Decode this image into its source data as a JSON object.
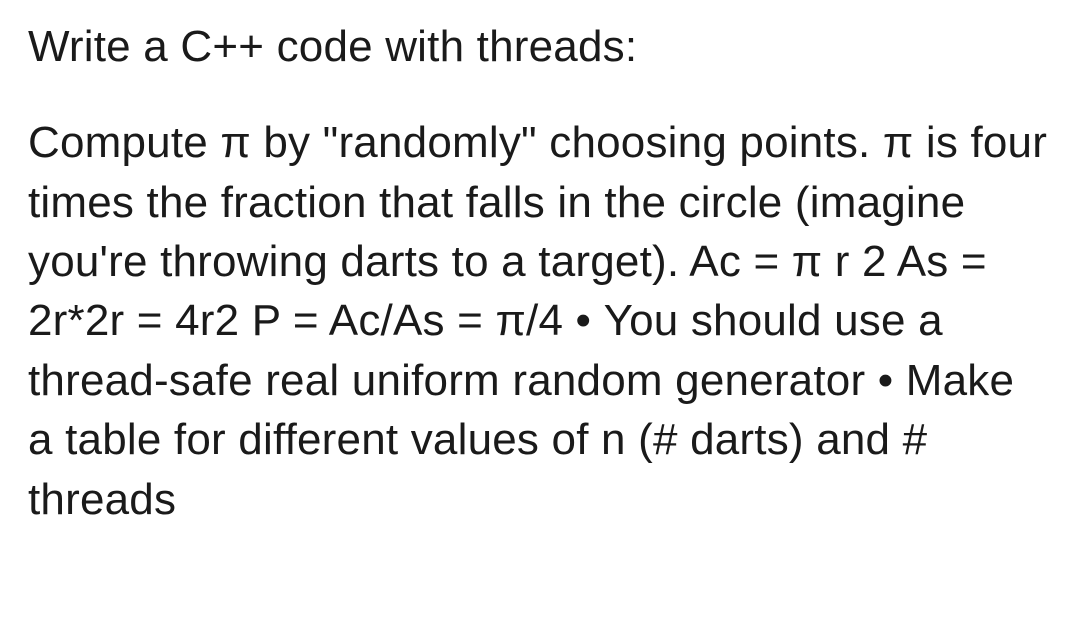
{
  "title": "Write a C++ code with threads:",
  "body": "Compute π by \"randomly\" choosing points. π is four times the fraction that falls in the circle (imagine you're throwing darts to a target). Ac = π r 2 As = 2r*2r = 4r2 P = Ac/As = π/4 • You should use a thread-safe real uniform random generator • Make a table for different values of n (# darts) and # threads"
}
